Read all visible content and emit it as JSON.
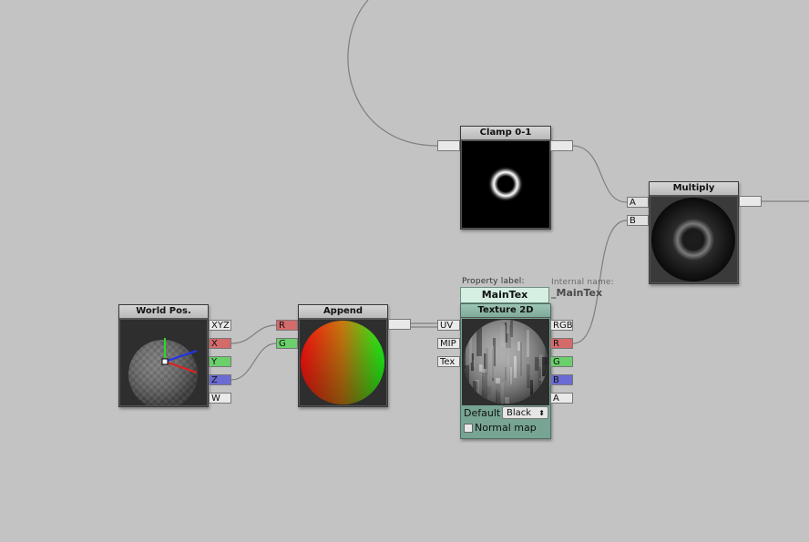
{
  "nodes": {
    "clamp": {
      "title": "Clamp 0-1"
    },
    "multiply": {
      "title": "Multiply",
      "inputs": [
        "A",
        "B"
      ]
    },
    "world_pos": {
      "title": "World Pos.",
      "outputs": [
        "XYZ",
        "X",
        "Y",
        "Z",
        "W"
      ]
    },
    "append": {
      "title": "Append",
      "inputs": [
        "R",
        "G"
      ]
    },
    "texture2d": {
      "property_label_caption": "Property label:",
      "internal_name_caption": "Internal name:",
      "property_label": "MainTex",
      "internal_name": "_MainTex",
      "title": "Texture 2D",
      "inputs": [
        "UV",
        "MIP",
        "Tex"
      ],
      "outputs": [
        "RGB",
        "R",
        "G",
        "B",
        "A"
      ],
      "default_label": "Default",
      "default_value": "Black",
      "dropdown_arrow": "⬍",
      "normal_map_label": "Normal map",
      "normal_map_checked": false
    }
  },
  "colors": {
    "canvas": "#c3c3c3",
    "wire": "#7a7a7a",
    "tex_node": "#77a493"
  }
}
